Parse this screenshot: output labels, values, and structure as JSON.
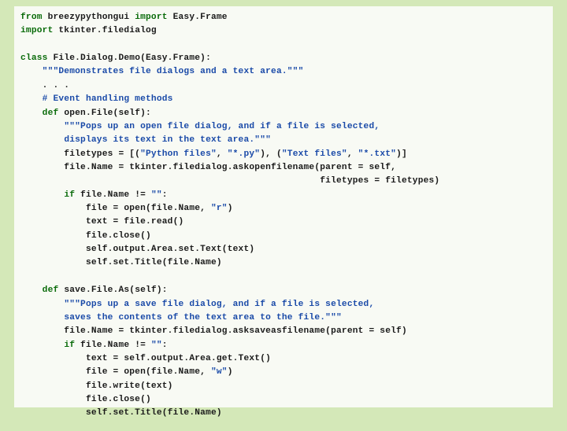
{
  "code": {
    "l1a": "from",
    "l1b": " breezypythongui ",
    "l1c": "import",
    "l1d": " Easy.Frame",
    "l2a": "import",
    "l2b": " tkinter.filedialog",
    "l3": "",
    "l4a": "class",
    "l4b": " File.Dialog.Demo(Easy.Frame):",
    "l5a": "    ",
    "l5b": "\"\"\"Demonstrates file dialogs and a text area.\"\"\"",
    "l6": "    . . .",
    "l7a": "    ",
    "l7b": "# Event handling methods",
    "l8a": "    ",
    "l8b": "def",
    "l8c": " open.File(self):",
    "l9a": "        ",
    "l9b": "\"\"\"Pops up an open file dialog, and if a file is selected,",
    "l10a": "        ",
    "l10b": "displays its text in the text area.\"\"\"",
    "l11a": "        filetypes = [(",
    "l11b": "\"Python files\"",
    "l11c": ", ",
    "l11d": "\"*.py\"",
    "l11e": "), (",
    "l11f": "\"Text files\"",
    "l11g": ", ",
    "l11h": "\"*.txt\"",
    "l11i": ")]",
    "l12": "        file.Name = tkinter.filedialog.askopenfilename(parent = self,",
    "l13": "                                                       filetypes = filetypes)",
    "l14a": "        ",
    "l14b": "if",
    "l14c": " file.Name != ",
    "l14d": "\"\"",
    "l14e": ":",
    "l15a": "            file = open(file.Name, ",
    "l15b": "\"r\"",
    "l15c": ")",
    "l16": "            text = file.read()",
    "l17": "            file.close()",
    "l18": "            self.output.Area.set.Text(text)",
    "l19": "            self.set.Title(file.Name)",
    "l20": "",
    "l21a": "    ",
    "l21b": "def",
    "l21c": " save.File.As(self):",
    "l22a": "        ",
    "l22b": "\"\"\"Pops up a save file dialog, and if a file is selected,",
    "l23a": "        ",
    "l23b": "saves the contents of the text area to the file.\"\"\"",
    "l24": "        file.Name = tkinter.filedialog.asksaveasfilename(parent = self)",
    "l25a": "        ",
    "l25b": "if",
    "l25c": " file.Name != ",
    "l25d": "\"\"",
    "l25e": ":",
    "l26": "            text = self.output.Area.get.Text()",
    "l27a": "            file = open(file.Name, ",
    "l27b": "\"w\"",
    "l27c": ")",
    "l28": "            file.write(text)",
    "l29": "            file.close()",
    "l30": "            self.set.Title(file.Name)"
  }
}
